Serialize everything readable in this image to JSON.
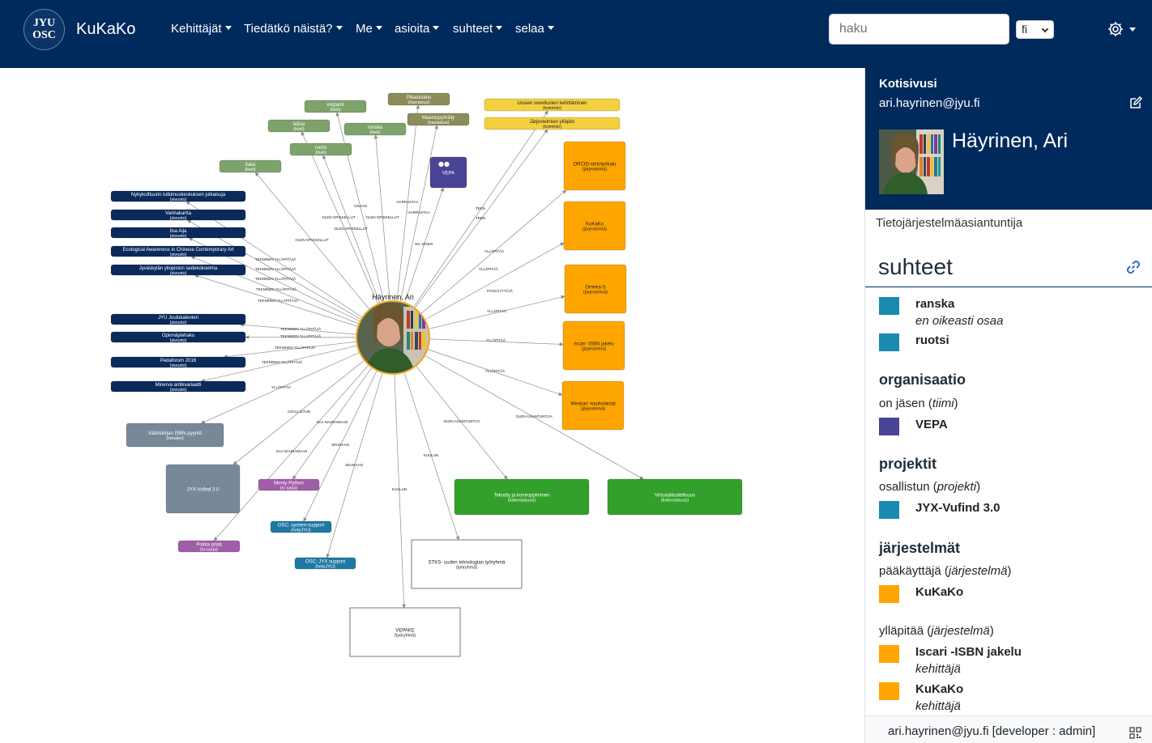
{
  "app": {
    "brand": "KuKaKo",
    "logo_line1": "JYU",
    "logo_line2": "OSC"
  },
  "nav": {
    "menus": [
      "Kehittäjät",
      "Tiedätkö näistä?",
      "Me",
      "asioita",
      "suhteet",
      "selaa"
    ],
    "search_placeholder": "haku",
    "language": "fi",
    "settings_icon": "gear-icon"
  },
  "profile": {
    "home_label": "Kotisivusi",
    "email": "ari.hayrinen@jyu.fi",
    "name": "Häyrinen, Ari",
    "title": "Tietojärjestelmäasiantuntija"
  },
  "relations": {
    "heading": "suhteet",
    "entries": [
      {
        "kind": "item",
        "name": "ranska",
        "sub": "en oikeasti osaa",
        "color": "#1b8ab0"
      },
      {
        "kind": "item",
        "name": "ruotsi",
        "sub": "",
        "color": "#1b8ab0"
      },
      {
        "kind": "section",
        "text": "organisaatio"
      },
      {
        "kind": "rel",
        "text": "on jäsen",
        "type": "tiimi"
      },
      {
        "kind": "item",
        "name": "VEPA",
        "sub": "",
        "color": "#4a4494"
      },
      {
        "kind": "section",
        "text": "projektit"
      },
      {
        "kind": "rel",
        "text": "osallistun",
        "type": "projekti"
      },
      {
        "kind": "item",
        "name": "JYX-Vufind 3.0",
        "sub": "",
        "color": "#1b8ab0"
      },
      {
        "kind": "section",
        "text": "järjestelmät"
      },
      {
        "kind": "rel",
        "text": "pääkäyttäjä",
        "type": "järjestelmä"
      },
      {
        "kind": "item",
        "name": "KuKaKo",
        "sub": "",
        "color": "#ffa500"
      },
      {
        "kind": "rel",
        "text": "ylläpitää",
        "type": "järjestelmä"
      },
      {
        "kind": "item",
        "name": "Iscari -ISBN jakelu",
        "sub": "kehittäjä",
        "color": "#ffa500"
      },
      {
        "kind": "item",
        "name": "KuKaKo",
        "sub": "kehittäjä",
        "color": "#ffa500"
      }
    ]
  },
  "footer": {
    "text": "ari.hayrinen@jyu.fi [developer : admin]"
  },
  "graph": {
    "center_label": "Häyrinen, Ari",
    "nodes": [
      {
        "label": "englanti",
        "sub": "(kieli)",
        "color": "#7ea36a"
      },
      {
        "label": "latina",
        "sub": "(kieli)",
        "color": "#7ea36a"
      },
      {
        "label": "ruotsi",
        "sub": "(kieli)",
        "color": "#7ea36a"
      },
      {
        "label": "ranska",
        "sub": "(kieli)",
        "color": "#7ea36a"
      },
      {
        "label": "italia",
        "sub": "(kieli)",
        "color": "#7ea36a"
      },
      {
        "label": "Pikaluistelu",
        "sub": "(harrastus)",
        "color": "#8c8c5a"
      },
      {
        "label": "Maastopyöräily",
        "sub": "(harrastus)",
        "color": "#8c8c5a"
      },
      {
        "label": "Uusien sovellusten kehittäminen",
        "sub": "(toiminto)",
        "color": "#f4d03f"
      },
      {
        "label": "Järjestelmien ylläpito",
        "sub": "(toiminto)",
        "color": "#f4d03f"
      },
      {
        "label": "VEPA",
        "sub": "",
        "color": "#4a4494"
      },
      {
        "label": "ORCID-siirtotyökalu",
        "sub": "(järjestelmä)",
        "color": "#ffa500"
      },
      {
        "label": "KuKaKo",
        "sub": "(järjestelmä)",
        "color": "#ffa500"
      },
      {
        "label": "Omeka-S",
        "sub": "(järjestelmä)",
        "color": "#ffa500"
      },
      {
        "label": "Iscari -ISBN jakelu",
        "sub": "(järjestelmä)",
        "color": "#ffa500"
      },
      {
        "label": "Weskari -kaukolainat",
        "sub": "(järjestelmä)",
        "color": "#ffa500"
      },
      {
        "label": "Nykykulttuurin tutkimuskeskuksen julkaisuja",
        "sub": "(sivusto)",
        "color": "#0b2a5c"
      },
      {
        "label": "Vanhakartta",
        "sub": "(sivusto)",
        "color": "#0b2a5c"
      },
      {
        "label": "Iisa Aija",
        "sub": "(sivusto)",
        "color": "#0b2a5c"
      },
      {
        "label": "Ecological Awareness in Chinese Contemporary Art",
        "sub": "(sivusto)",
        "color": "#0b2a5c"
      },
      {
        "label": "Jyväskylän yliopiston taidekokoelma",
        "sub": "(sivusto)",
        "color": "#0b2a5c"
      },
      {
        "label": "JYU Joulukalenteri",
        "sub": "(sivusto)",
        "color": "#0b2a5c"
      },
      {
        "label": "Opinnäytehaku",
        "sub": "(sivusto)",
        "color": "#0b2a5c"
      },
      {
        "label": "Pedaforum 2016",
        "sub": "(sivusto)",
        "color": "#0b2a5c"
      },
      {
        "label": "Minerva antikvariaatti",
        "sub": "(sivusto)",
        "color": "#0b2a5c"
      },
      {
        "label": "Väitöskirjan ISBN-pyyntö",
        "sub": "(lomake)",
        "color": "#778899"
      },
      {
        "label": "JYX-Vufind 3.0",
        "sub": "",
        "color": "#778899"
      },
      {
        "label": "Monty Python",
        "sub": "(tv-sarja)",
        "color": "#a05da8"
      },
      {
        "label": "Pokka pitää",
        "sub": "(tv-sarja)",
        "color": "#a05da8"
      },
      {
        "label": "OSC: system-support",
        "sub": "(helpJYU)",
        "color": "#1f78a4"
      },
      {
        "label": "OSC: JYX support",
        "sub": "(helpJYU)",
        "color": "#1f78a4"
      },
      {
        "label": "Tekoäly ja koneoppiminen",
        "sub": "(kokonaisuus)",
        "color": "#33a02c"
      },
      {
        "label": "Virtuaalitodellisuus",
        "sub": "(kokonaisuus)",
        "color": "#33a02c"
      },
      {
        "label": "STKS- uuden teknologian työryhmä",
        "sub": "(työryhmä)",
        "color": "#ffffff"
      },
      {
        "label": "VEPAKE",
        "sub": "(työryhmä)",
        "color": "#ffffff"
      }
    ],
    "edge_labels": [
      "OSAAN",
      "OLEN OPISKELLUT",
      "OLEN OPISKELLUT",
      "OLEN OPISKELLUT",
      "OLEN OPISKELLUT",
      "HARRASTAA",
      "HARRASTAA",
      "ON JÄSEN",
      "TEEN",
      "TEEN",
      "YLLÄPITÄÄ",
      "YLLÄPITÄÄ",
      "PÄÄKÄYTTÄJÄ",
      "YLLÄPITÄÄ",
      "YLLÄPITÄÄ",
      "YLLÄPITÄÄ",
      "TEKNINEN YLLÄPITÄJÄ",
      "TEKNINEN YLLÄPITÄJÄ",
      "TEKNINEN YLLÄPITÄJÄ",
      "TEKNINEN YLLÄPITÄJÄ",
      "TEKNINEN YLLÄPITÄJÄ",
      "TEKNINEN YLLÄPITÄJÄ",
      "TEKNINEN YLLÄPITÄJÄ",
      "TEKNINEN YLLÄPITÄJÄ",
      "TEKNINEN YLLÄPITÄJÄ",
      "YLLÄPITÄÄ",
      "OSALLISTUN",
      "SAA NAURAMAAN",
      "SAA NAURAMAAN",
      "SEURAAN",
      "SEURAAN",
      "KUULUN",
      "KUULUN",
      "OLEN ASIANTUNTIJA",
      "OLEN ASIANTUNTIJA"
    ]
  }
}
